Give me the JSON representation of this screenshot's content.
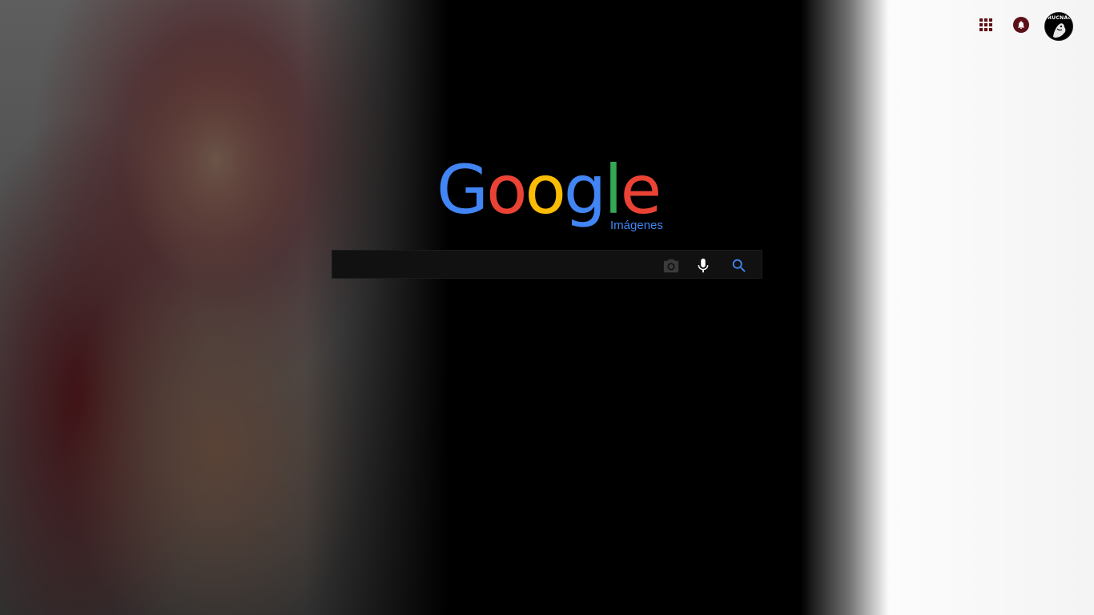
{
  "logo": {
    "text": "Google",
    "subtitle": "Imágenes",
    "colors": {
      "blue": "#4285F4",
      "red": "#EA4335",
      "yellow": "#FBBC05",
      "green": "#34A853"
    }
  },
  "header": {
    "apps_icon": "apps-grid-icon",
    "notifications_icon": "bell-icon",
    "avatar_text": "IRUCNAC"
  },
  "search": {
    "value": "",
    "placeholder": "",
    "camera_icon": "camera-icon",
    "mic_icon": "microphone-icon",
    "search_icon": "magnifier-icon",
    "search_icon_color": "#4285F4"
  },
  "theme": {
    "background": "#000000",
    "accent": "#5C1117"
  }
}
